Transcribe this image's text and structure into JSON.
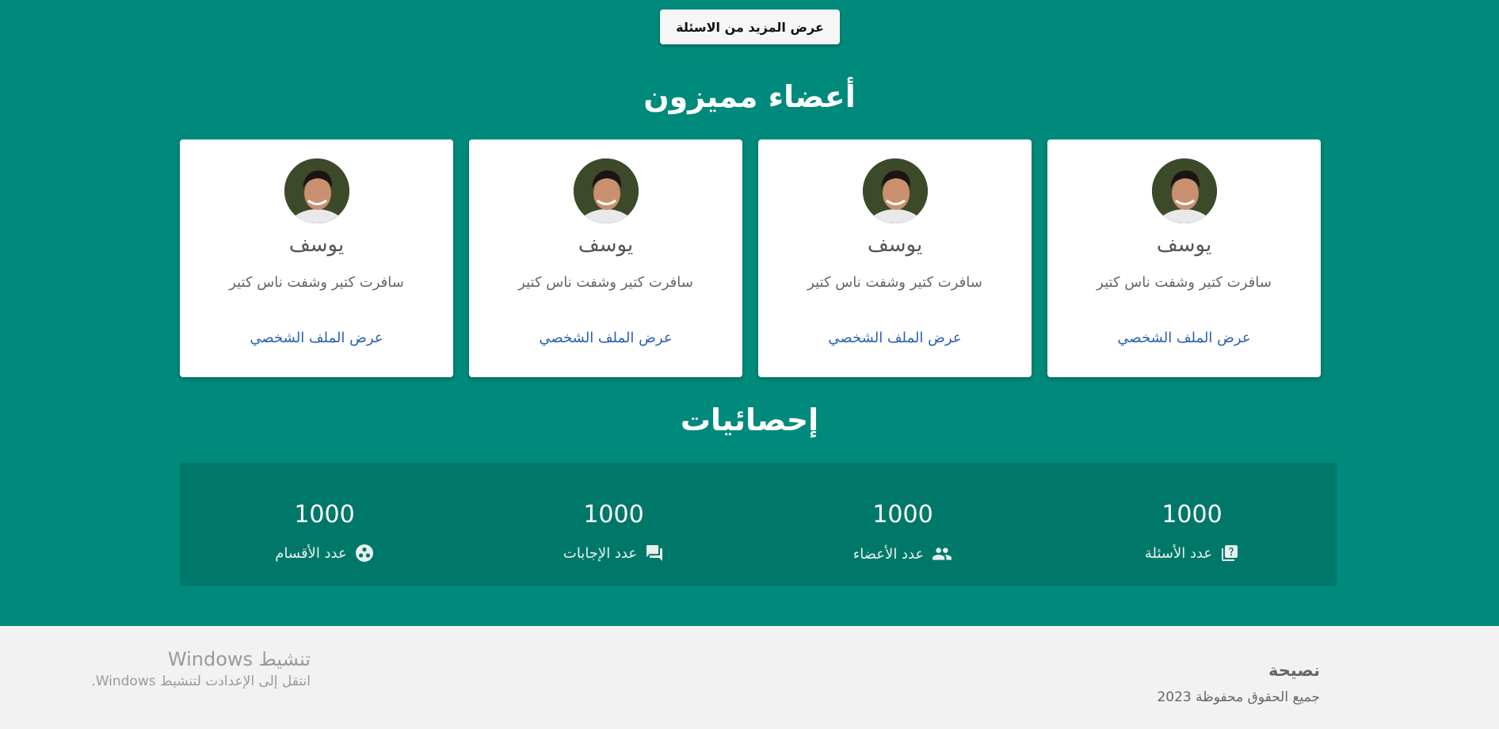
{
  "more_questions_button": "عرض المزيد من الاسئلة",
  "featured": {
    "title": "أعضاء مميزون",
    "members": [
      {
        "name": "يوسف",
        "bio": "سافرت كتير وشفت ناس كتير",
        "link": "عرض الملف الشخصي"
      },
      {
        "name": "يوسف",
        "bio": "سافرت كتير وشفت ناس كتير",
        "link": "عرض الملف الشخصي"
      },
      {
        "name": "يوسف",
        "bio": "سافرت كتير وشفت ناس كتير",
        "link": "عرض الملف الشخصي"
      },
      {
        "name": "يوسف",
        "bio": "سافرت كتير وشفت ناس كتير",
        "link": "عرض الملف الشخصي"
      }
    ]
  },
  "stats": {
    "title": "إحصائيات",
    "items": [
      {
        "value": "1000",
        "label": "عدد الأسئلة",
        "icon": "question-book-icon"
      },
      {
        "value": "1000",
        "label": "عدد الأعضاء",
        "icon": "people-icon"
      },
      {
        "value": "1000",
        "label": "عدد الإجابات",
        "icon": "chat-bubbles-icon"
      },
      {
        "value": "1000",
        "label": "عدد الأقسام",
        "icon": "workspaces-icon"
      }
    ]
  },
  "footer": {
    "brand": "نصيحة",
    "copyright": "جميع الحقوق محفوظة 2023"
  },
  "windows_activation": {
    "title": "تنشيط Windows",
    "subtitle": "انتقل إلى الإعدادت لتنشيط Windows."
  },
  "colors": {
    "background": "#008a7b",
    "stats_panel": "#007869",
    "link": "#2a5fb5",
    "footer": "#f2f2f2"
  }
}
